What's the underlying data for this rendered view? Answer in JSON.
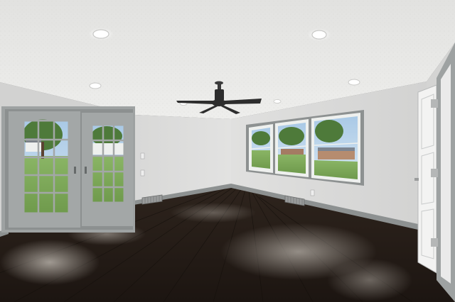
{
  "scene": {
    "kind": "empty room interior photograph",
    "features": [
      "textured-ceiling",
      "recessed-lights",
      "ceiling-fan",
      "french-doors",
      "window-bank",
      "interior-door",
      "dark-hardwood-floor",
      "baseboards",
      "floor-vents",
      "wall-outlets"
    ],
    "recessed_light_count": 5,
    "window_count": 3,
    "french_door_panel_count": 2,
    "colors": {
      "ceiling": "#e6e6e4",
      "wall_back": "#dcdcdb",
      "wall_left": "#d3d3d2",
      "wall_right": "#d8d8d7",
      "trim": "#8d9191",
      "door_frame": "#9ea2a2",
      "floor_dark": "#241c17",
      "floor_mid": "#3a2d24",
      "floor_highlight": "#8c8680",
      "lawn": "#7fa85a",
      "sky": "#bcd6ea",
      "foliage": "#4e7a3a",
      "fan": "#2d2d2d"
    }
  }
}
